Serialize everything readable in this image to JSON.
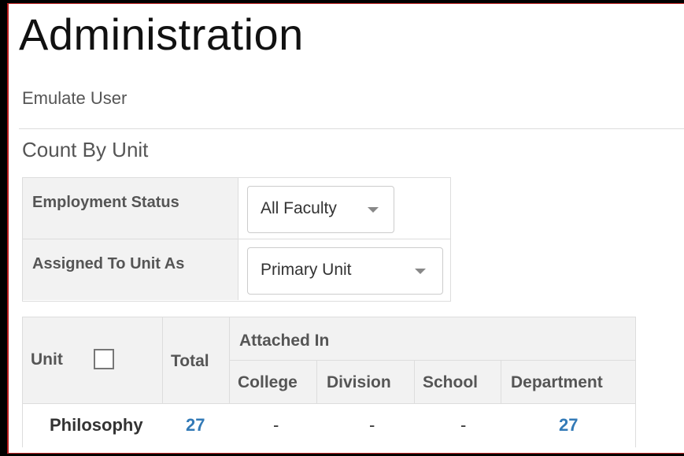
{
  "page": {
    "title": "Administration",
    "emulate_link": "Emulate User",
    "section_title": "Count By Unit"
  },
  "filters": {
    "employment_status": {
      "label": "Employment Status",
      "selected": "All Faculty"
    },
    "assigned_unit": {
      "label": "Assigned To Unit As",
      "selected": "Primary Unit"
    }
  },
  "table": {
    "headers": {
      "unit": "Unit",
      "total": "Total",
      "attached_in": "Attached In",
      "college": "College",
      "division": "Division",
      "school": "School",
      "department": "Department"
    },
    "rows": [
      {
        "unit": "Philosophy",
        "total": "27",
        "college": "-",
        "division": "-",
        "school": "-",
        "department": "27"
      }
    ]
  },
  "colors": {
    "link": "#337ab7",
    "header_bg": "#f2f2f2",
    "frame": "#000000",
    "accent_red": "#c62828"
  }
}
